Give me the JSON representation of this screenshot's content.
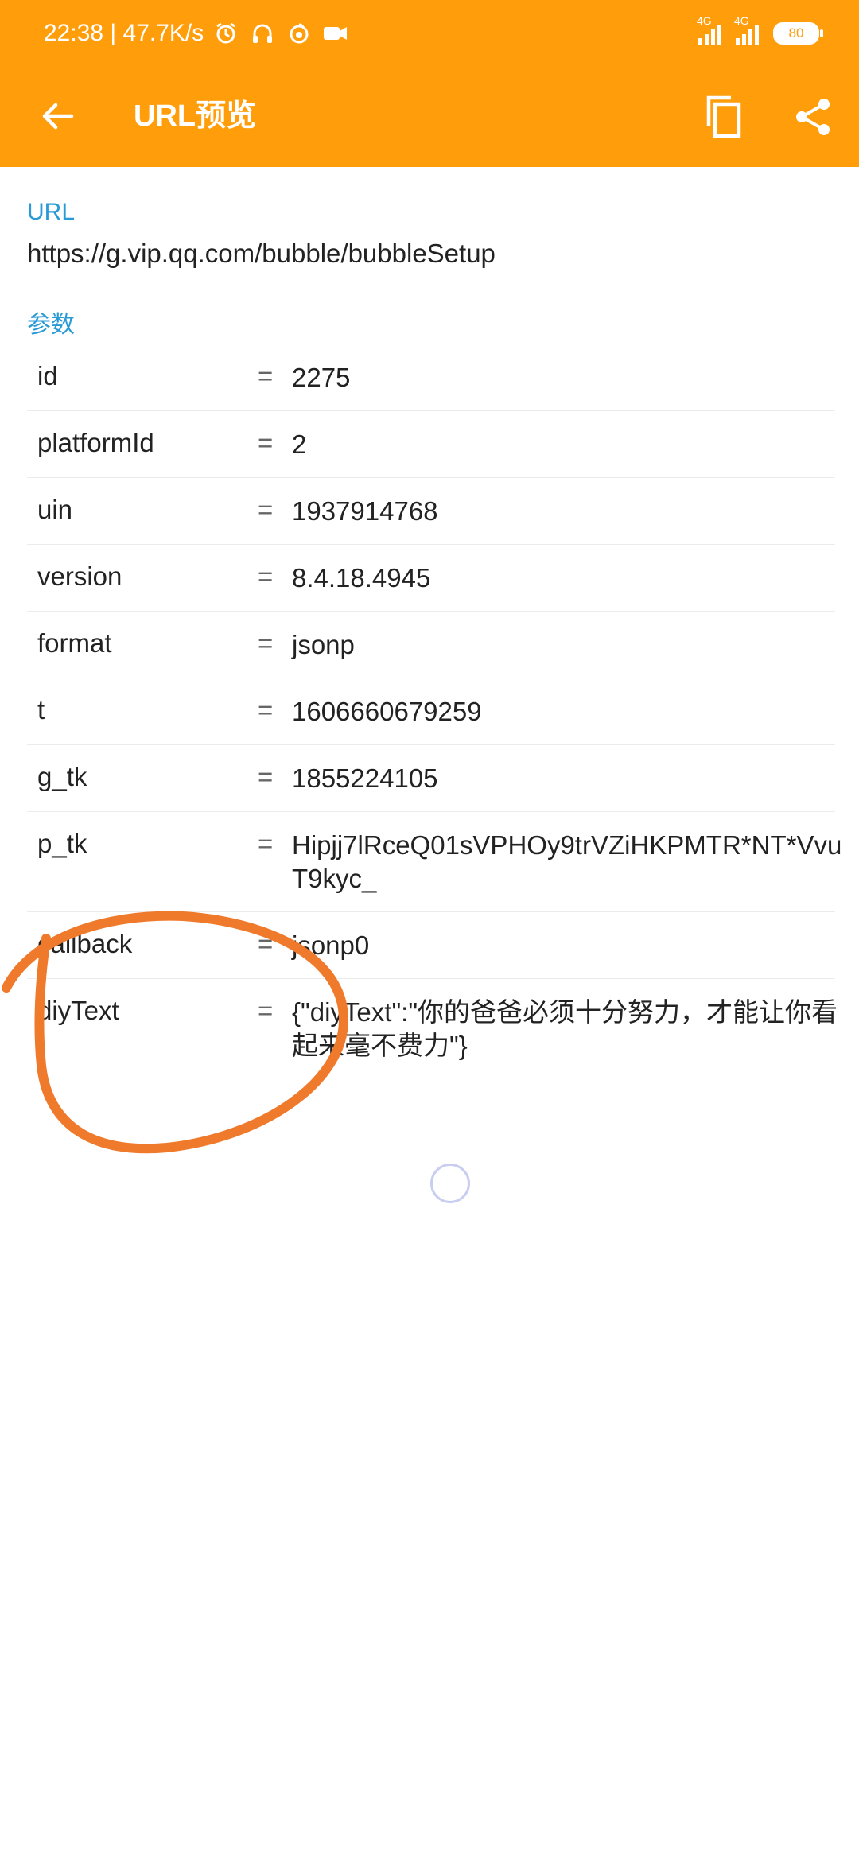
{
  "status_bar": {
    "time_speed": "22:38 | 47.7K/s",
    "signal1_label": "4G",
    "signal2_label": "4G",
    "battery": "80"
  },
  "toolbar": {
    "title": "URL预览",
    "back_icon": "arrow-left-icon",
    "copy_icon": "copy-icon",
    "share_icon": "share-icon"
  },
  "url_section": {
    "label": "URL",
    "value": "https://g.vip.qq.com/bubble/bubbleSetup"
  },
  "params_section": {
    "label": "参数",
    "rows": [
      {
        "key": "id",
        "eq": "=",
        "value": "2275"
      },
      {
        "key": "platformId",
        "eq": "=",
        "value": "2"
      },
      {
        "key": "uin",
        "eq": "=",
        "value": "1937914768"
      },
      {
        "key": "version",
        "eq": "=",
        "value": "8.4.18.4945"
      },
      {
        "key": "format",
        "eq": "=",
        "value": "jsonp"
      },
      {
        "key": "t",
        "eq": "=",
        "value": "1606660679259"
      },
      {
        "key": "g_tk",
        "eq": "=",
        "value": "1855224105"
      },
      {
        "key": "p_tk",
        "eq": "=",
        "value": "Hipjj7lRceQ01sVPHOy9trVZiHKPMTR*NT*VvuT9kyc_"
      },
      {
        "key": "callback",
        "eq": "=",
        "value": "jsonp0"
      },
      {
        "key": "diyText",
        "eq": "=",
        "value": "{\"diyText\":\"你的爸爸必须十分努力，才能让你看起来毫不费力\"}"
      }
    ]
  },
  "colors": {
    "appbar": "#ff9d0a",
    "section_label": "#2a9ad6",
    "annotation_stroke": "#f07a2c"
  }
}
